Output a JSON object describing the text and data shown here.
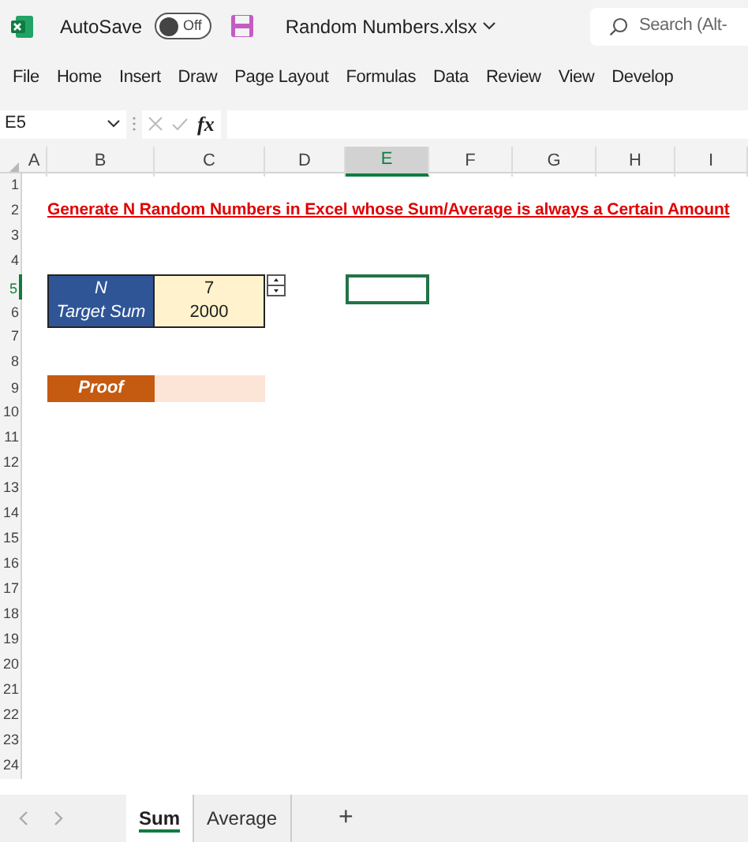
{
  "title_bar": {
    "autosave_label": "AutoSave",
    "autosave": {
      "on": false,
      "label": "Off"
    },
    "file_name": "Random Numbers.xlsx",
    "search_placeholder": "Search (Alt-"
  },
  "ribbon_tabs": [
    {
      "label": "File"
    },
    {
      "label": "Home"
    },
    {
      "label": "Insert"
    },
    {
      "label": "Draw"
    },
    {
      "label": "Page Layout"
    },
    {
      "label": "Formulas"
    },
    {
      "label": "Data"
    },
    {
      "label": "Review"
    },
    {
      "label": "View"
    },
    {
      "label": "Develop"
    }
  ],
  "formula_bar": {
    "name_box": "E5",
    "function_symbol": "fx"
  },
  "columns": [
    {
      "label": "A",
      "selected": false
    },
    {
      "label": "B",
      "selected": false
    },
    {
      "label": "C",
      "selected": false
    },
    {
      "label": "D",
      "selected": false
    },
    {
      "label": "E",
      "selected": true
    },
    {
      "label": "F",
      "selected": false
    },
    {
      "label": "G",
      "selected": false
    },
    {
      "label": "H",
      "selected": false
    },
    {
      "label": "I",
      "selected": false
    }
  ],
  "rows": [
    {
      "label": "1",
      "selected": false
    },
    {
      "label": "2",
      "selected": false
    },
    {
      "label": "3",
      "selected": false
    },
    {
      "label": "4",
      "selected": false
    },
    {
      "label": "5",
      "selected": true
    },
    {
      "label": "6",
      "selected": false
    },
    {
      "label": "7",
      "selected": false
    },
    {
      "label": "8",
      "selected": false
    },
    {
      "label": "9",
      "selected": false
    },
    {
      "label": "10",
      "selected": false
    },
    {
      "label": "11",
      "selected": false
    },
    {
      "label": "12",
      "selected": false
    },
    {
      "label": "13",
      "selected": false
    },
    {
      "label": "14",
      "selected": false
    },
    {
      "label": "15",
      "selected": false
    },
    {
      "label": "16",
      "selected": false
    },
    {
      "label": "17",
      "selected": false
    },
    {
      "label": "18",
      "selected": false
    },
    {
      "label": "19",
      "selected": false
    },
    {
      "label": "20",
      "selected": false
    },
    {
      "label": "21",
      "selected": false
    },
    {
      "label": "22",
      "selected": false
    },
    {
      "label": "23",
      "selected": false
    },
    {
      "label": "24",
      "selected": false
    }
  ],
  "sheet": {
    "title": "Generate N Random Numbers in Excel whose Sum/Average is always a Certain Amount",
    "inputs": [
      {
        "label": "N",
        "value": "7"
      },
      {
        "label": "Target Sum",
        "value": "2000"
      }
    ],
    "proof_label": "Proof"
  },
  "sheet_tabs": [
    {
      "label": "Sum",
      "selected": true
    },
    {
      "label": "Average",
      "selected": false
    }
  ],
  "add_sheet": "+"
}
